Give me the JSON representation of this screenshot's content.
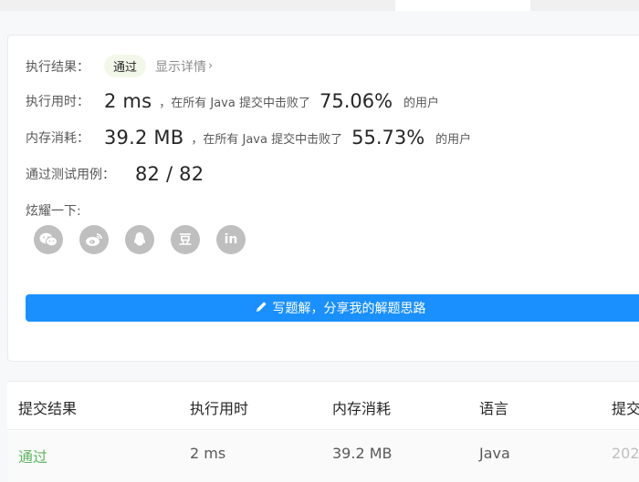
{
  "result": {
    "label": "执行结果：",
    "status": "通过",
    "details_link": "显示详情",
    "details_chevron": "›"
  },
  "runtime": {
    "label": "执行用时：",
    "value": "2 ms",
    "note": "，在所有 Java 提交中击败了",
    "percent": "75.06%",
    "users": "的用户"
  },
  "memory": {
    "label": "内存消耗：",
    "value": "39.2 MB",
    "note": "，在所有 Java 提交中击败了",
    "percent": "55.73%",
    "users": "的用户"
  },
  "testcases": {
    "label": "通过测试用例：",
    "value": "82 / 82"
  },
  "share": {
    "label": "炫耀一下:",
    "icons": [
      "wechat-icon",
      "weibo-icon",
      "qq-icon",
      "douban-icon",
      "linkedin-icon"
    ],
    "douban_glyph": "豆",
    "linkedin_glyph": "in"
  },
  "write_button": {
    "label": "写题解，分享我的解题思路"
  },
  "table": {
    "headers": [
      "提交结果",
      "执行用时",
      "内存消耗",
      "语言",
      "提交"
    ],
    "rows": [
      {
        "status": "通过",
        "runtime": "2 ms",
        "memory": "39.2 MB",
        "language": "Java",
        "time_clipped": "202"
      }
    ]
  },
  "colors": {
    "accent": "#1a90ff",
    "success": "#5cb85c",
    "icon_gray": "#bfbfbf"
  }
}
